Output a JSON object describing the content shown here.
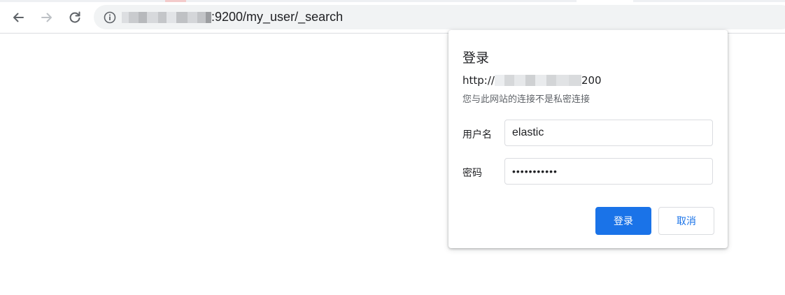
{
  "browser": {
    "url_visible_suffix": ":9200/my_user/_search",
    "icons": {
      "back": "arrow-left-icon",
      "forward": "arrow-right-icon",
      "reload": "reload-icon",
      "site_info": "info-icon"
    }
  },
  "dialog": {
    "title": "登录",
    "origin_prefix": "http://",
    "origin_suffix": "200",
    "warning": "您与此网站的连接不是私密连接",
    "username_label": "用户名",
    "username_value": "elastic",
    "password_label": "密码",
    "password_masked": "•••••••••••",
    "submit_label": "登录",
    "cancel_label": "取消"
  },
  "colors": {
    "accent": "#1a73e8",
    "omnibox_bg": "#f1f3f4",
    "text_primary": "#202124",
    "text_secondary": "#5f6368"
  }
}
